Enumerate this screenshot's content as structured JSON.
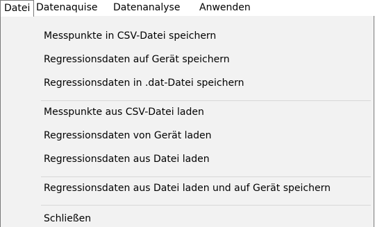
{
  "menubar": {
    "items": [
      "Datei",
      "Datenaquise",
      "Datenanalyse",
      "Anwenden"
    ]
  },
  "datei_menu": {
    "group1": [
      "Messpunkte in CSV-Datei speichern",
      "Regressionsdaten auf Gerät speichern",
      "Regressionsdaten in .dat-Datei speichern"
    ],
    "group2": [
      "Messpunkte aus CSV-Datei laden",
      "Regressionsdaten von Gerät laden",
      "Regressionsdaten aus Datei laden"
    ],
    "group3": [
      "Regressionsdaten aus Datei laden und auf Gerät speichern"
    ],
    "group4": [
      "Schließen"
    ]
  }
}
